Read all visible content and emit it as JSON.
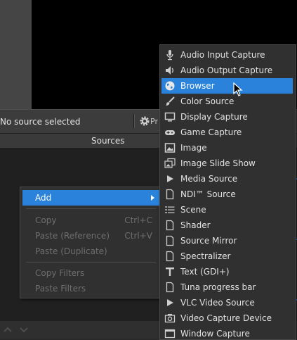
{
  "status_bar": {
    "no_source_text": "No source selected",
    "properties_label": "Pr"
  },
  "sources_dock": {
    "title": "Sources"
  },
  "context_menu": {
    "items": [
      {
        "label": "Add",
        "shortcut": "",
        "state": "active",
        "has_submenu": true
      },
      {
        "label": "Copy",
        "shortcut": "Ctrl+C",
        "state": "disabled"
      },
      {
        "label": "Paste (Reference)",
        "shortcut": "Ctrl+V",
        "state": "disabled"
      },
      {
        "label": "Paste (Duplicate)",
        "shortcut": "",
        "state": "disabled"
      },
      {
        "label": "Copy Filters",
        "shortcut": "",
        "state": "disabled"
      },
      {
        "label": "Paste Filters",
        "shortcut": "",
        "state": "disabled"
      }
    ]
  },
  "add_submenu": {
    "items": [
      {
        "label": "Audio Input Capture",
        "icon": "microphone-icon"
      },
      {
        "label": "Audio Output Capture",
        "icon": "speaker-icon"
      },
      {
        "label": "Browser",
        "icon": "globe-icon",
        "state": "highlighted"
      },
      {
        "label": "Color Source",
        "icon": "paint-brush-icon"
      },
      {
        "label": "Display Capture",
        "icon": "monitor-icon"
      },
      {
        "label": "Game Capture",
        "icon": "gamepad-icon"
      },
      {
        "label": "Image",
        "icon": "image-icon"
      },
      {
        "label": "Image Slide Show",
        "icon": "slideshow-icon"
      },
      {
        "label": "Media Source",
        "icon": "play-icon"
      },
      {
        "label": "NDI™ Source",
        "icon": "file-icon"
      },
      {
        "label": "Scene",
        "icon": "list-icon"
      },
      {
        "label": "Shader",
        "icon": "file-icon"
      },
      {
        "label": "Source Mirror",
        "icon": "file-icon"
      },
      {
        "label": "Spectralizer",
        "icon": "file-icon"
      },
      {
        "label": "Text (GDI+)",
        "icon": "text-icon"
      },
      {
        "label": "Tuna progress bar",
        "icon": "file-icon"
      },
      {
        "label": "VLC Video Source",
        "icon": "play-icon"
      },
      {
        "label": "Video Capture Device",
        "icon": "camera-icon"
      },
      {
        "label": "Window Capture",
        "icon": "window-icon"
      }
    ]
  },
  "colors": {
    "highlight": "#2a82da",
    "menu_bg": "#303030",
    "disabled_text": "#6e6e6e"
  }
}
